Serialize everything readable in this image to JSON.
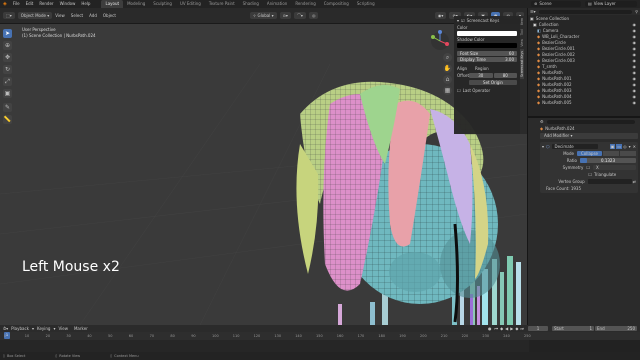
{
  "menus": [
    "File",
    "Edit",
    "Render",
    "Window",
    "Help"
  ],
  "workspace_tabs": [
    "Layout",
    "Modeling",
    "Sculpting",
    "UV Editing",
    "Texture Paint",
    "Shading",
    "Animation",
    "Rendering",
    "Compositing",
    "Scripting"
  ],
  "scene": {
    "name": "Scene",
    "view_layer": "View Layer"
  },
  "viewport_header": {
    "mode": "Object Mode",
    "view": "View",
    "select": "Select",
    "add": "Add",
    "object": "Object",
    "orientation": "Global"
  },
  "viewport": {
    "line1": "User Perspective",
    "line2": "(1) Scene Collection | NurbsPath.024",
    "overlay_caption": "Left Mouse x2"
  },
  "npanel": {
    "title": "Screencast Keys",
    "color_label": "Color",
    "shadow_label": "Shadow Color",
    "font_size_label": "Font Size",
    "font_size_value": "60",
    "display_time_label": "Display Time",
    "display_time_value": "3.00",
    "align_label": "Align",
    "region_label": "Region",
    "offset_label": "Offset",
    "offset_x": "30",
    "offset_y": "80",
    "set_origin": "Set Origin",
    "last_operator": "Last Operator",
    "tabs": [
      "Item",
      "Tool",
      "View",
      "Screencast Keys"
    ]
  },
  "outliner": {
    "header": "Scene Collection",
    "items": [
      "Collection",
      "Camera",
      "WB_Loli_Character",
      "BezierCircle",
      "BezierCircle.001",
      "BezierCircle.002",
      "BezierCircle.003",
      "T_smth",
      "NurbsPath",
      "NurbsPath.001",
      "NurbsPath.002",
      "NurbsPath.003",
      "NurbsPath.004",
      "NurbsPath.005"
    ]
  },
  "properties": {
    "object": "NurbsPath.024",
    "add_modifier": "Add Modifier",
    "modifier": "Decimate",
    "mode_label": "Mode",
    "mode_value": "Collapse",
    "ratio_label": "Ratio",
    "ratio_value": "0.1323",
    "symmetry_label": "Symmetry",
    "symmetry_axis": "X",
    "triangulate": "Triangulate",
    "vertex_group": "Vertex Group",
    "face_count": "Face Count: 1935"
  },
  "timeline": {
    "menus": [
      "Playback",
      "Keying",
      "View",
      "Marker"
    ],
    "current_frame": "1",
    "start_label": "Start",
    "start_value": "1",
    "end_label": "End",
    "end_value": "250",
    "ruler": [
      "0",
      "10",
      "20",
      "30",
      "40",
      "50",
      "60",
      "70",
      "80",
      "90",
      "100",
      "110",
      "120",
      "130",
      "140",
      "150",
      "160",
      "170",
      "180",
      "190",
      "200",
      "210",
      "220",
      "230",
      "240",
      "250"
    ],
    "status": [
      "Box Select",
      "Rotate View",
      "Context Menu"
    ]
  },
  "colors": {
    "accent": "#4772b3",
    "background": "#3a3a3a"
  }
}
